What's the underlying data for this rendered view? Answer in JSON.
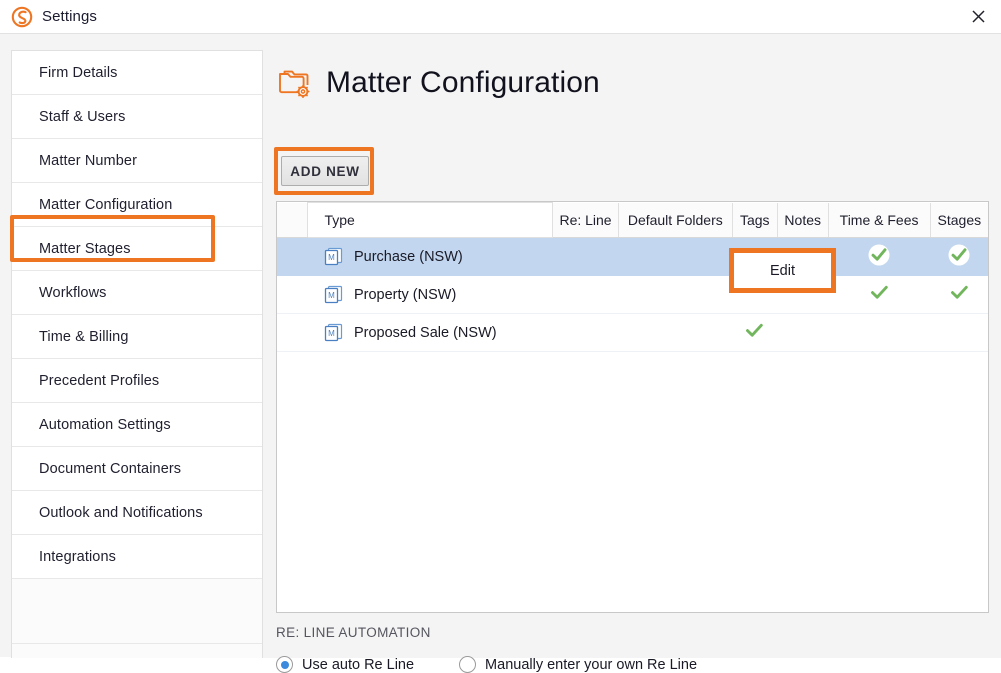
{
  "window": {
    "title": "Settings",
    "logo_icon": "smokeball-s-logo-icon",
    "close_icon": "close-icon"
  },
  "sidebar": {
    "items": [
      {
        "label": "Firm Details",
        "selected": false
      },
      {
        "label": "Staff & Users",
        "selected": false
      },
      {
        "label": "Matter Number",
        "selected": false
      },
      {
        "label": "Matter Configuration",
        "selected": true
      },
      {
        "label": "Matter Stages",
        "selected": false
      },
      {
        "label": "Workflows",
        "selected": false
      },
      {
        "label": "Time & Billing",
        "selected": false
      },
      {
        "label": "Precedent Profiles",
        "selected": false
      },
      {
        "label": "Automation Settings",
        "selected": false
      },
      {
        "label": "Document Containers",
        "selected": false
      },
      {
        "label": "Outlook and Notifications",
        "selected": false
      },
      {
        "label": "Integrations",
        "selected": false
      }
    ]
  },
  "main": {
    "page_icon": "folder-gear-icon",
    "page_title": "Matter Configuration",
    "add_new_label": "ADD NEW",
    "tooltip": {
      "label": "Edit"
    }
  },
  "table": {
    "columns": [
      {
        "key": "grip",
        "label": ""
      },
      {
        "key": "type",
        "label": "Type"
      },
      {
        "key": "reline",
        "label": "Re: Line"
      },
      {
        "key": "folders",
        "label": "Default Folders"
      },
      {
        "key": "tags",
        "label": "Tags"
      },
      {
        "key": "notes",
        "label": "Notes"
      },
      {
        "key": "timefees",
        "label": "Time & Fees"
      },
      {
        "key": "stages",
        "label": "Stages"
      }
    ],
    "rows": [
      {
        "icon": "matter-document-icon",
        "type": "Purchase (NSW)",
        "selected": true,
        "reline": false,
        "folders": false,
        "tags": false,
        "notes": false,
        "timefees": true,
        "stages": true
      },
      {
        "icon": "matter-document-icon",
        "type": "Property (NSW)",
        "selected": false,
        "reline": false,
        "folders": false,
        "tags": false,
        "notes": false,
        "timefees": true,
        "stages": true
      },
      {
        "icon": "matter-document-icon",
        "type": "Proposed Sale (NSW)",
        "selected": false,
        "reline": false,
        "folders": false,
        "tags": true,
        "notes": false,
        "timefees": false,
        "stages": false
      }
    ]
  },
  "reline": {
    "section_label": "RE: LINE AUTOMATION",
    "options": [
      {
        "label": "Use auto Re Line",
        "checked": true
      },
      {
        "label": "Manually enter your own Re Line",
        "checked": false
      }
    ]
  },
  "colors": {
    "accent_orange": "#ee7623",
    "selection_blue": "#c2d7ef",
    "check_green": "#71b55c",
    "radio_blue": "#3b8ade",
    "icon_blue": "#5b8ec9"
  }
}
